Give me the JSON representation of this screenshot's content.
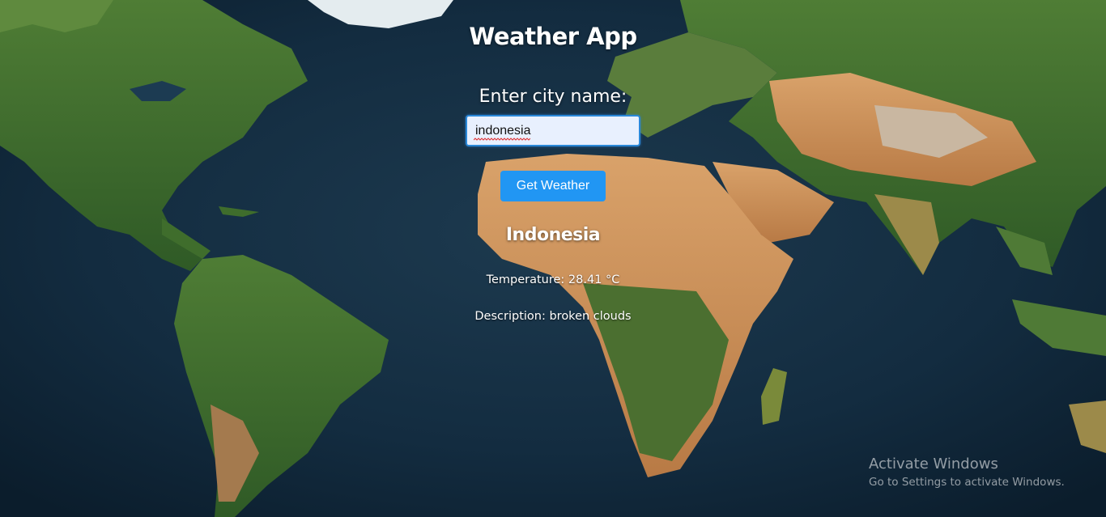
{
  "app": {
    "title": "Weather App",
    "city_label": "Enter city name:",
    "city_input_value": "indonesia",
    "get_weather_label": "Get Weather"
  },
  "result": {
    "city": "Indonesia",
    "temperature_text": "Temperature: 28.41 °C",
    "description_text": "Description: broken clouds"
  },
  "watermark": {
    "title": "Activate Windows",
    "subtitle": "Go to Settings to activate Windows."
  },
  "colors": {
    "button": "#2196f3",
    "input_border": "#2a88d8",
    "input_bg": "#e8f0fe",
    "ocean": "#102638"
  }
}
